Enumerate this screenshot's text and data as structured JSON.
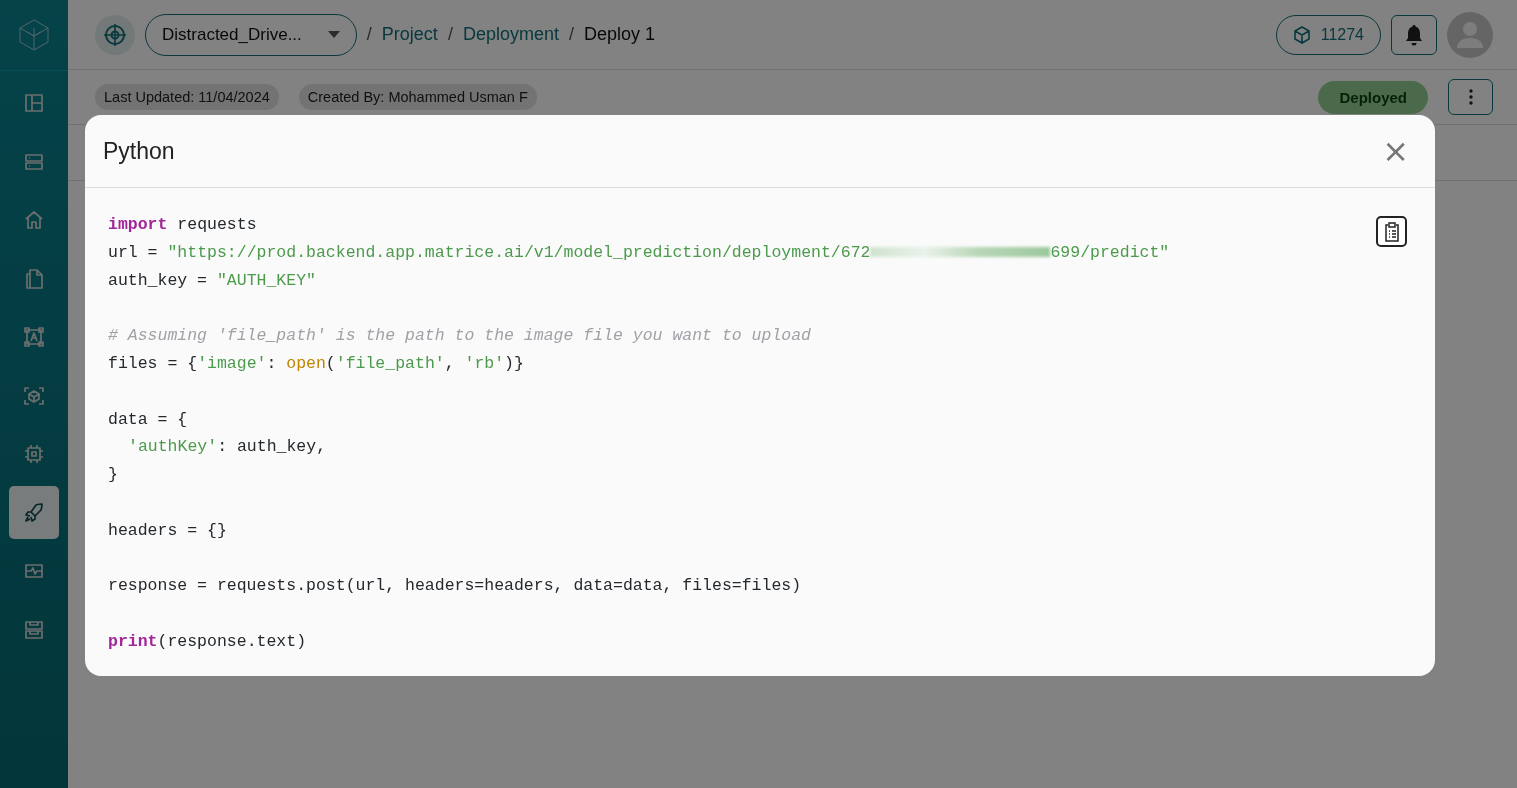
{
  "sidebar": {
    "items": [
      {
        "selected": false
      },
      {
        "selected": false
      },
      {
        "selected": false
      },
      {
        "selected": false
      },
      {
        "selected": false
      },
      {
        "selected": false
      },
      {
        "selected": false
      },
      {
        "selected": false
      },
      {
        "selected": true
      },
      {
        "selected": false
      },
      {
        "selected": false
      }
    ]
  },
  "header": {
    "project": "Distracted_Drive...",
    "breadcrumbs": [
      {
        "label": "Project",
        "current": false
      },
      {
        "label": "Deployment",
        "current": false
      },
      {
        "label": "Deploy 1",
        "current": true
      }
    ],
    "separator": "/",
    "credits": "11274"
  },
  "subheader": {
    "chips": [
      "Last Updated: 11/04/2024",
      "Created By: Mohammed Usman F"
    ],
    "status": "Deployed"
  },
  "modal": {
    "title": "Python",
    "close": "×",
    "code": [
      {
        "kind": "code",
        "indented": false,
        "tokens": [
          {
            "kind": "keyword",
            "text": "import"
          },
          {
            "kind": "plain",
            "text": " requests"
          }
        ]
      },
      {
        "kind": "code",
        "indented": false,
        "tokens": [
          {
            "kind": "plain",
            "text": "url = "
          },
          {
            "kind": "string",
            "text": "\"https://prod.backend.app.matrice.ai/v1/model_prediction/deployment/672"
          },
          {
            "kind": "redacted"
          },
          {
            "kind": "string",
            "text": "699/predict\""
          }
        ]
      },
      {
        "kind": "code",
        "indented": false,
        "tokens": [
          {
            "kind": "plain",
            "text": "auth_key = "
          },
          {
            "kind": "string",
            "text": "\"AUTH_KEY\""
          }
        ]
      },
      {
        "kind": "blank"
      },
      {
        "kind": "code",
        "indented": false,
        "tokens": [
          {
            "kind": "comment",
            "text": "# Assuming 'file_path' is the path to the image file you want to upload"
          }
        ]
      },
      {
        "kind": "code",
        "indented": false,
        "tokens": [
          {
            "kind": "plain",
            "text": "files = {"
          },
          {
            "kind": "string",
            "text": "'image'"
          },
          {
            "kind": "plain",
            "text": ": "
          },
          {
            "kind": "builtin",
            "text": "open"
          },
          {
            "kind": "plain",
            "text": "("
          },
          {
            "kind": "string",
            "text": "'file_path'"
          },
          {
            "kind": "plain",
            "text": ", "
          },
          {
            "kind": "string",
            "text": "'rb'"
          },
          {
            "kind": "plain",
            "text": ")}"
          }
        ]
      },
      {
        "kind": "blank"
      },
      {
        "kind": "code",
        "indented": false,
        "tokens": [
          {
            "kind": "plain",
            "text": "data = {"
          }
        ]
      },
      {
        "kind": "code",
        "indented": true,
        "tokens": [
          {
            "kind": "string",
            "text": "'authKey'"
          },
          {
            "kind": "plain",
            "text": ": auth_key,"
          }
        ]
      },
      {
        "kind": "code",
        "indented": false,
        "tokens": [
          {
            "kind": "plain",
            "text": "}"
          }
        ]
      },
      {
        "kind": "blank"
      },
      {
        "kind": "code",
        "indented": false,
        "tokens": [
          {
            "kind": "plain",
            "text": "headers = {}"
          }
        ]
      },
      {
        "kind": "blank"
      },
      {
        "kind": "code",
        "indented": false,
        "tokens": [
          {
            "kind": "plain",
            "text": "response = requests.post(url, headers=headers, data=data, files=files)"
          }
        ]
      },
      {
        "kind": "blank"
      },
      {
        "kind": "code",
        "indented": false,
        "tokens": [
          {
            "kind": "keyword",
            "text": "print"
          },
          {
            "kind": "plain",
            "text": "(response.text)"
          }
        ]
      }
    ]
  }
}
